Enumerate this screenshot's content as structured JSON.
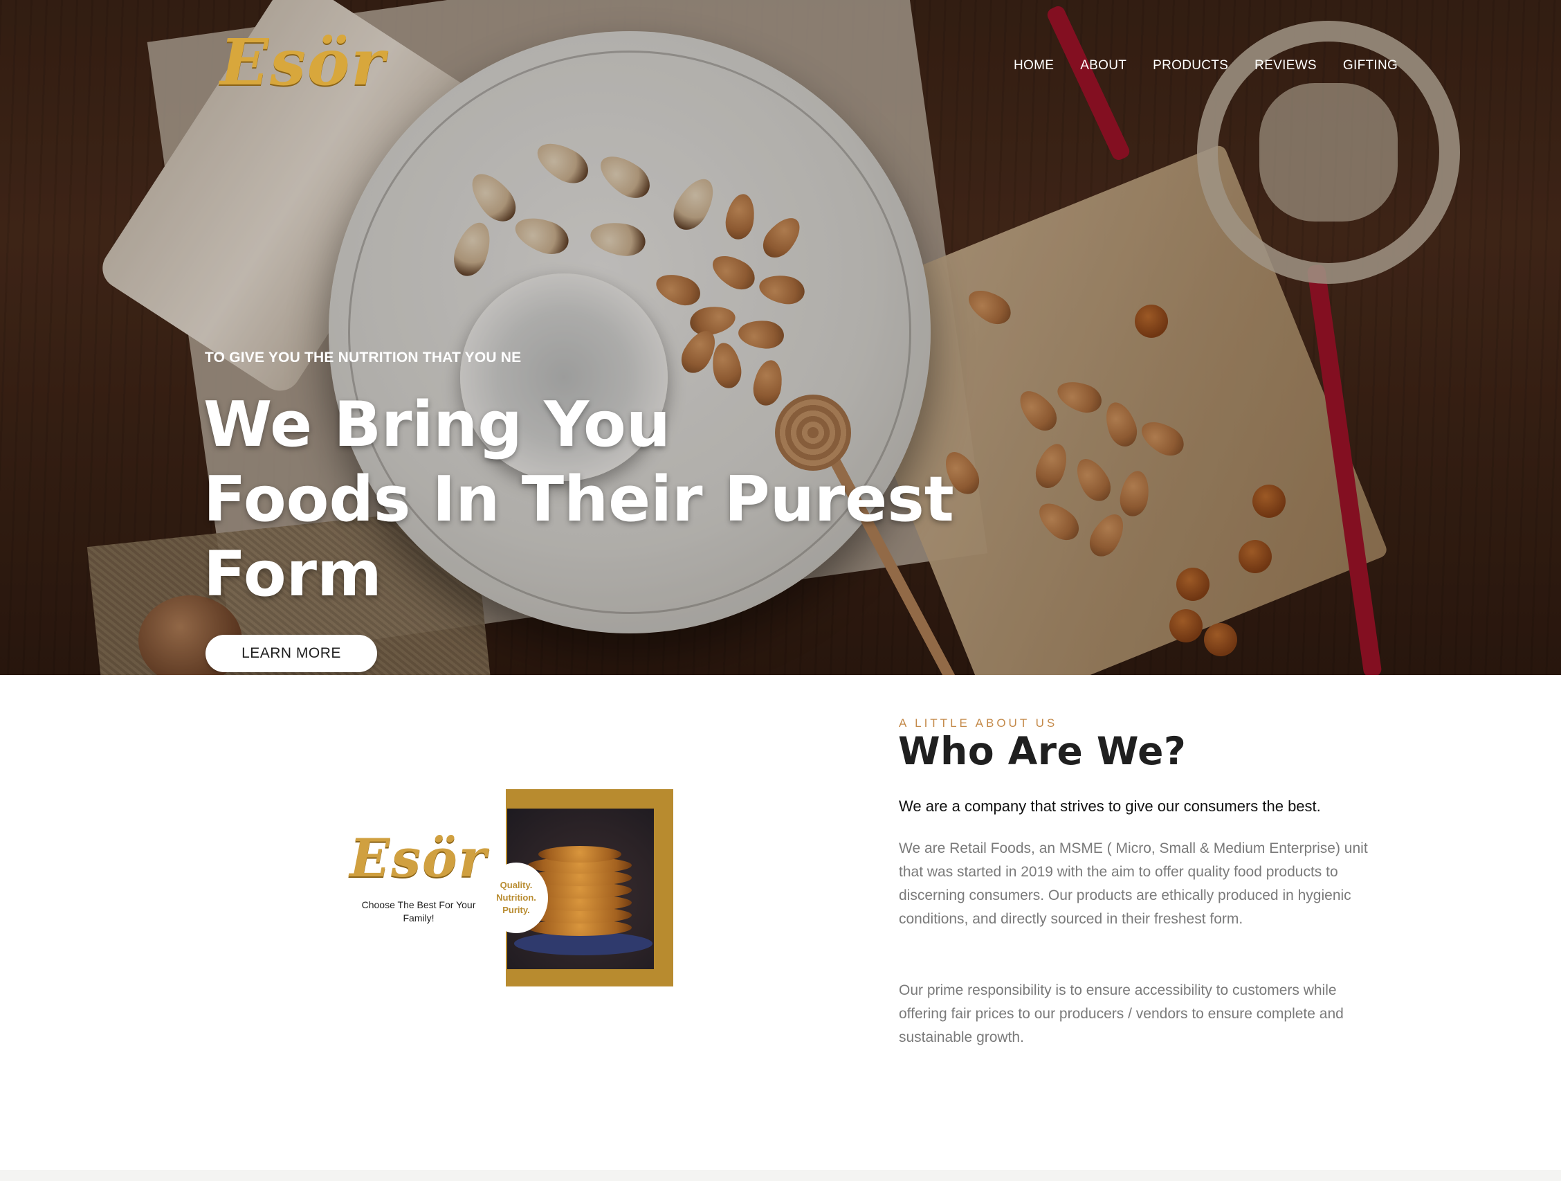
{
  "brand": {
    "logo_text": "Esör"
  },
  "nav": {
    "items": [
      "HOME",
      "ABOUT",
      "PRODUCTS",
      "REVIEWS",
      "GIFTING"
    ]
  },
  "hero": {
    "kicker": "TO GIVE YOU THE NUTRITION THAT YOU NE",
    "title_lines": [
      "We Bring You",
      "Foods In Their Purest",
      "Form"
    ],
    "cta_label": "LEARN MORE"
  },
  "promo": {
    "logo_text": "Esör",
    "tagline": "Choose The Best For Your Family!",
    "badge_lines": [
      "Quality.",
      "Nutrition.",
      "Purity."
    ]
  },
  "about": {
    "kicker": "A LITTLE ABOUT US",
    "title": "Who Are We?",
    "lead": "We are a company that strives to give our consumers the best.",
    "paragraphs": [
      "We are Retail Foods, an MSME ( Micro, Small & Medium Enterprise) unit that was started in 2019 with the aim to offer quality food products to discerning consumers. Our products are ethically produced in hygienic conditions, and directly sourced in their freshest form.",
      "Our prime responsibility is to ensure accessibility to customers while offering fair prices to our producers / vendors to ensure complete and sustainable growth."
    ]
  },
  "colors": {
    "accent_gold": "#b88b2f",
    "logo_gold": "#d8a73c",
    "kicker_orange": "#c48a4a",
    "body_grey": "#7a7a7a"
  }
}
